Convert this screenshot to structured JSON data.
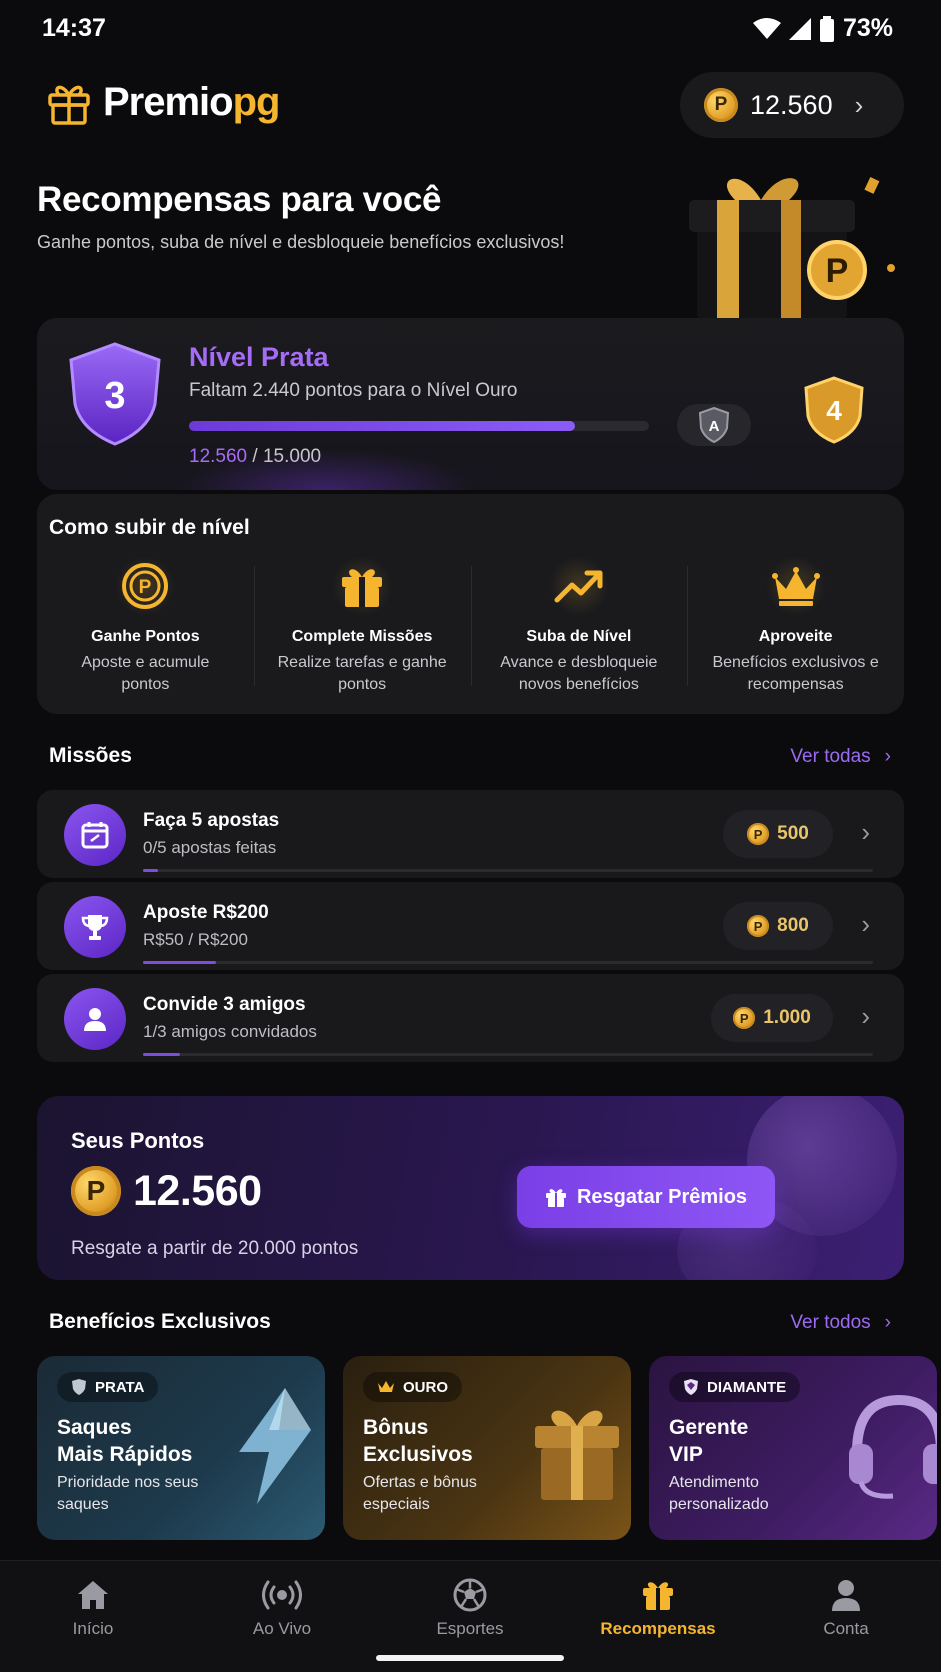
{
  "status": {
    "time": "14:37",
    "battery": "73%"
  },
  "brand": {
    "name_a": "Premio",
    "name_b": "pg",
    "accent": "#f5b52e"
  },
  "header": {
    "balance": "12.560"
  },
  "hero": {
    "title": "Recompensas para você",
    "subtitle": "Ganhe pontos, suba de nível e desbloqueie benefícios exclusivos!"
  },
  "level": {
    "current_number": "3",
    "name": "Nível Prata",
    "remaining_text": "Faltam 2.440 pontos para o Nível Ouro",
    "points_current": "12.560",
    "points_separator": " / ",
    "points_target": "15.000",
    "progress_fraction": 0.84,
    "small_badge_letter": "A",
    "next_number": "4",
    "accent": "#a56cf6"
  },
  "how_to": {
    "title": "Como subir de nível",
    "items": [
      {
        "icon": "coin-icon",
        "name": "Ganhe Pontos",
        "desc": "Aposte e acumule pontos"
      },
      {
        "icon": "gift-icon",
        "name": "Complete Missões",
        "desc": "Realize tarefas e ganhe pontos"
      },
      {
        "icon": "trend-up-icon",
        "name": "Suba de Nível",
        "desc": "Avance e desbloqueie novos benefícios"
      },
      {
        "icon": "crown-icon",
        "name": "Aproveite",
        "desc": "Benefícios exclusivos e recompensas"
      }
    ]
  },
  "missions": {
    "title": "Missões",
    "see_all": "Ver todas",
    "items": [
      {
        "icon": "calendar-icon",
        "title": "Faça 5 apostas",
        "sub": "0/5 apostas feitas",
        "reward": "500",
        "progress": 0.02
      },
      {
        "icon": "trophy-icon",
        "title": "Aposte R$200",
        "sub": "R$50 / R$200",
        "reward": "800",
        "progress": 0.1
      },
      {
        "icon": "user-icon",
        "title": "Convide 3 amigos",
        "sub": "1/3 amigos convidados",
        "reward": "1.000",
        "progress": 0.05
      }
    ]
  },
  "points": {
    "label": "Seus Pontos",
    "value": "12.560",
    "note": "Resgate a partir de 20.000 pontos",
    "button": "Resgatar Prêmios"
  },
  "benefits": {
    "title": "Benefícios Exclusivos",
    "see_all": "Ver todos",
    "items": [
      {
        "tag": "PRATA",
        "title_1": "Saques",
        "title_2": "Mais Rápidos",
        "desc": "Prioridade nos seus saques"
      },
      {
        "tag": "OURO",
        "title_1": "Bônus",
        "title_2": "Exclusivos",
        "desc": "Ofertas e bônus especiais"
      },
      {
        "tag": "DIAMANTE",
        "title_1": "Gerente",
        "title_2": "VIP",
        "desc": "Atendimento personalizado"
      }
    ]
  },
  "nav": {
    "items": [
      {
        "label": "Início",
        "icon": "home-icon"
      },
      {
        "label": "Ao Vivo",
        "icon": "live-icon"
      },
      {
        "label": "Esportes",
        "icon": "soccer-ball-icon"
      },
      {
        "label": "Recompensas",
        "icon": "gift-icon",
        "active": true
      },
      {
        "label": "Conta",
        "icon": "user-icon"
      }
    ]
  }
}
